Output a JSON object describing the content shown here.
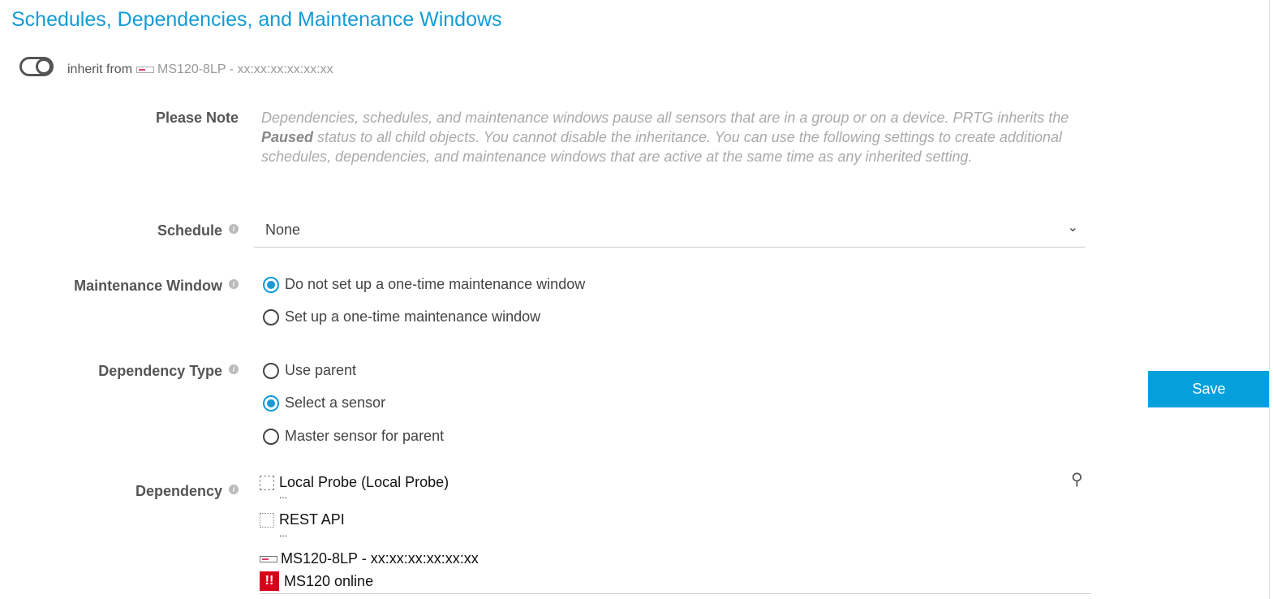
{
  "title": "Schedules, Dependencies, and Maintenance Windows",
  "inherit": {
    "label": "inherit from",
    "device": "MS120-8LP - xx:xx:xx:xx:xx:xx",
    "enabled": false
  },
  "note": {
    "label": "Please Note",
    "text_before": "Dependencies, schedules, and maintenance windows pause all sensors that are in a group or on a device. PRTG inherits the ",
    "bold": "Paused",
    "text_after": " status to all child objects. You cannot disable the inheritance. You can use the following settings to create additional schedules, dependencies, and maintenance windows that are active at the same time as any inherited setting."
  },
  "schedule": {
    "label": "Schedule",
    "value": "None"
  },
  "maintenance": {
    "label": "Maintenance Window",
    "options": [
      "Do not set up a one-time maintenance window",
      "Set up a one-time maintenance window"
    ],
    "selected": 0
  },
  "dependency_type": {
    "label": "Dependency Type",
    "options": [
      "Use parent",
      "Select a sensor",
      "Master sensor for parent"
    ],
    "selected": 1
  },
  "dependency": {
    "label": "Dependency",
    "path": [
      "Local Probe (Local Probe)",
      "REST API",
      "MS120-8LP - xx:xx:xx:xx:xx:xx",
      "MS120 online"
    ],
    "ellipsis": "..."
  },
  "save_label": "Save",
  "colors": {
    "accent": "#139bd6",
    "alert": "#d9001b"
  }
}
